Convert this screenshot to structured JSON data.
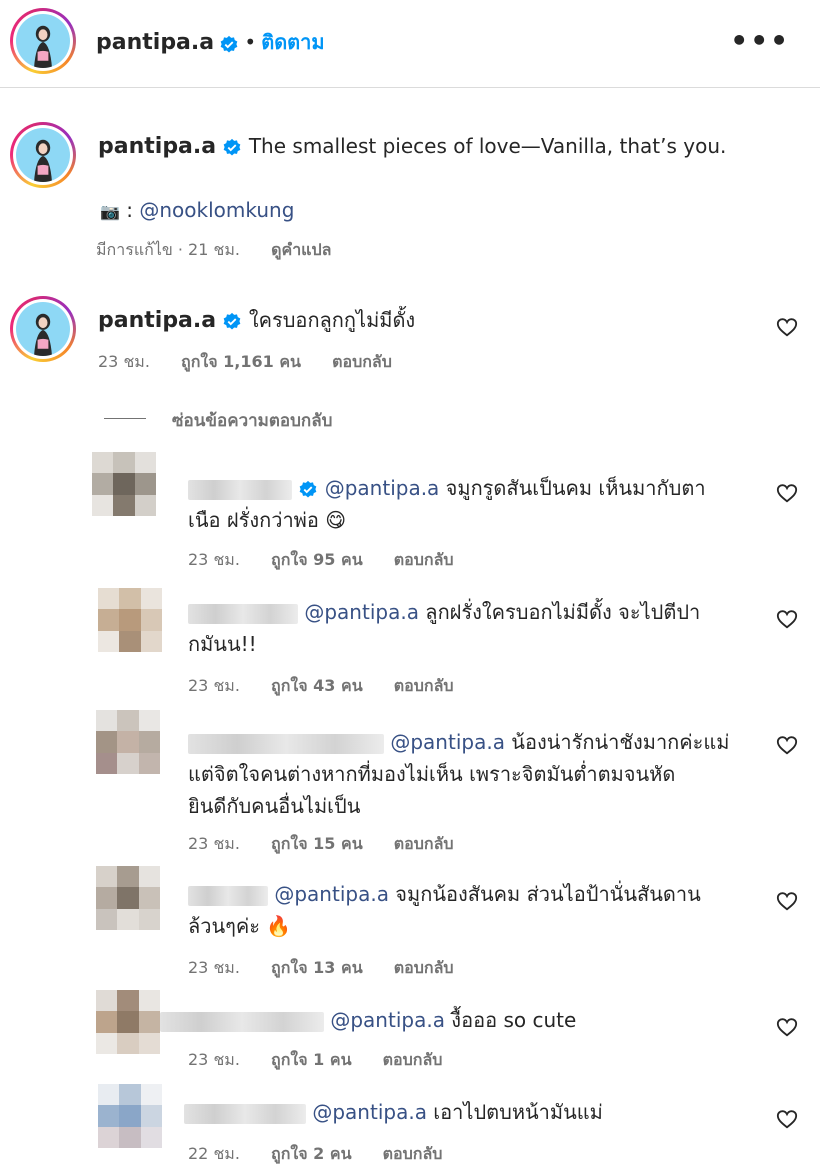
{
  "header": {
    "username": "pantipa.a",
    "separator": "•",
    "follow_label": "ติดตาม",
    "more_label": "•••"
  },
  "caption": {
    "username": "pantipa.a",
    "text": "The smallest pieces of love—Vanilla, that’s you.",
    "camera_emoji": "📷",
    "credit_prefix": " : ",
    "credit_mention": "@nooklomkung",
    "edited": "มีการแก้ไข · 21 ชม.",
    "translate": "ดูคำแปล"
  },
  "pinned_comment": {
    "username": "pantipa.a",
    "text": "ใครบอกลูกกูไม่มีดั้ง",
    "time": "23 ชม.",
    "likes": "ถูกใจ 1,161 คน",
    "reply": "ตอบกลับ"
  },
  "hide_replies": "ซ่อนข้อความตอบกลับ",
  "replies": [
    {
      "mention": "@pantipa.a",
      "line1": " จมูกรูดสันเป็นคม เห็นมากับตา",
      "line2": "เนือ ฝรั่งกว่าพ่อ 😋",
      "time": "23 ชม.",
      "likes": "ถูกใจ 95 คน",
      "reply": "ตอบกลับ"
    },
    {
      "mention": "@pantipa.a",
      "line1": " ลูกฝรั่งใครบอกไม่มีดั้ง จะไปตีปา",
      "line2": "กมันน!!",
      "time": "23 ชม.",
      "likes": "ถูกใจ 43 คน",
      "reply": "ตอบกลับ"
    },
    {
      "mention": "@pantipa.a",
      "line1": " น้องน่ารักน่าชังมากค่ะแม่",
      "line2": "แต่จิตใจคนต่างหากที่มองไม่เห็น เพราะจิตมันต่ำตมจนหัด",
      "line3": "ยินดีกับคนอื่นไม่เป็น",
      "time": "23 ชม.",
      "likes": "ถูกใจ 15 คน",
      "reply": "ตอบกลับ"
    },
    {
      "mention": "@pantipa.a",
      "line1": " จมูกน้องสันคม ส่วนไอป้านั่นสันดาน",
      "line2": "ล้วนๆค่ะ 🔥",
      "time": "23 ชม.",
      "likes": "ถูกใจ 13 คน",
      "reply": "ตอบกลับ"
    },
    {
      "mention": "@pantipa.a",
      "line1": " งื้อออ so cute",
      "time": "23 ชม.",
      "likes": "ถูกใจ 1 คน",
      "reply": "ตอบกลับ"
    },
    {
      "mention": "@pantipa.a",
      "line1": " เอาไปตบหน้ามันแม่",
      "time": "22 ชม.",
      "likes": "ถูกใจ 2 คน",
      "reply": "ตอบกลับ"
    }
  ],
  "icons": {
    "verified": "verified-badge-icon",
    "heart": "heart-outline-icon",
    "more": "more-horizontal-icon"
  },
  "colors": {
    "link": "#0095f6",
    "mention": "#385185",
    "verified": "#0095f6",
    "muted": "#737373"
  }
}
